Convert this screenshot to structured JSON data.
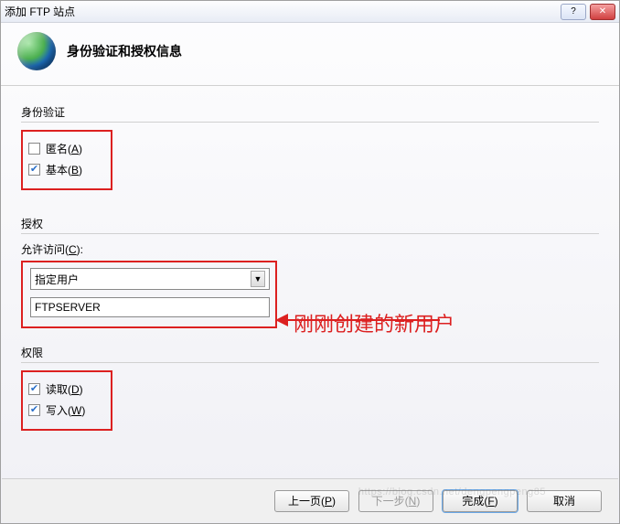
{
  "window": {
    "title": "添加 FTP 站点"
  },
  "header": {
    "title": "身份验证和授权信息"
  },
  "auth": {
    "section_label": "身份验证",
    "anonymous": {
      "label_pre": "匿名(",
      "accel": "A",
      "label_post": ")",
      "checked": false
    },
    "basic": {
      "label_pre": "基本(",
      "accel": "B",
      "label_post": ")",
      "checked": true
    }
  },
  "authz": {
    "section_label": "授权",
    "allow_access_label_pre": "允许访问(",
    "allow_access_accel": "C",
    "allow_access_label_post": "):",
    "select_value": "指定用户",
    "input_value": "FTPSERVER"
  },
  "perm": {
    "section_label": "权限",
    "read": {
      "label_pre": "读取(",
      "accel": "D",
      "label_post": ")",
      "checked": true
    },
    "write": {
      "label_pre": "写入(",
      "accel": "W",
      "label_post": ")",
      "checked": true
    }
  },
  "buttons": {
    "prev_pre": "上一页(",
    "prev_accel": "P",
    "prev_post": ")",
    "next_pre": "下一步(",
    "next_accel": "N",
    "next_post": ")",
    "finish_pre": "完成(",
    "finish_accel": "F",
    "finish_post": ")",
    "cancel": "取消"
  },
  "annotation": {
    "text": "刚刚创建的新用户"
  },
  "watermark": {
    "text": "https://blog.csdn.net/dengpengpeng85"
  }
}
